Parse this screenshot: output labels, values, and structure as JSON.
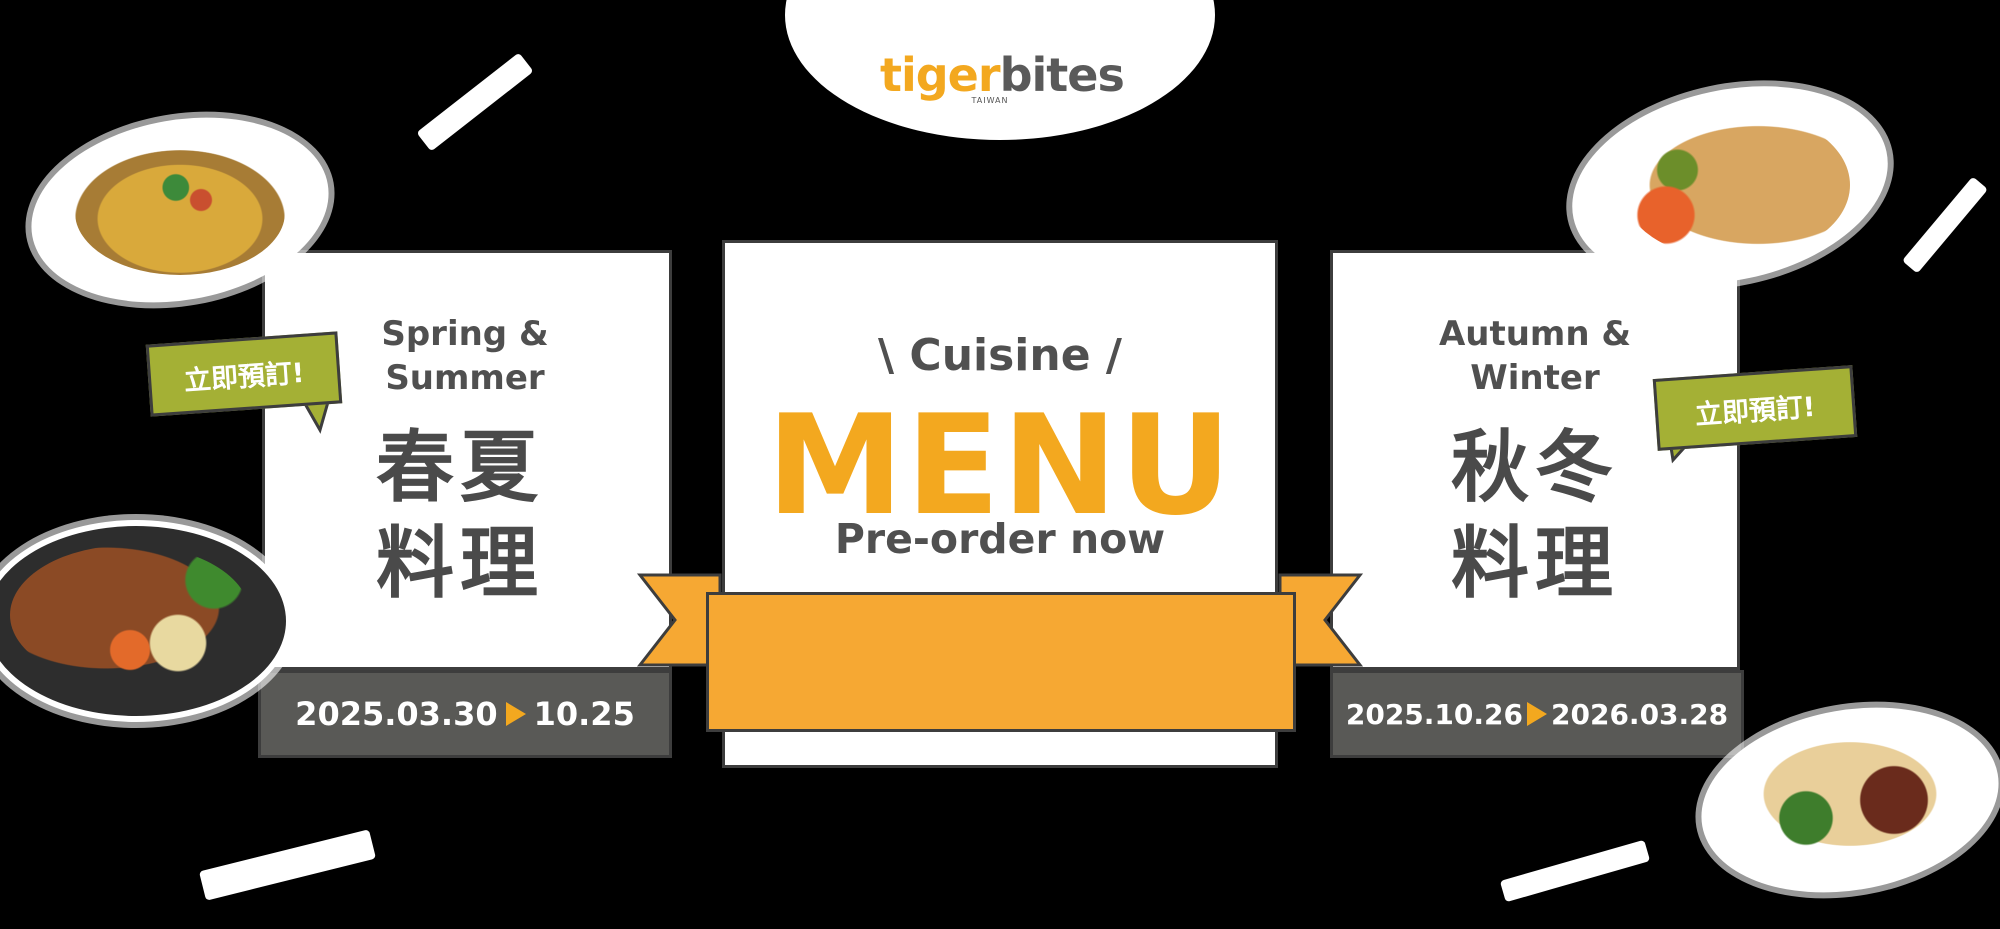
{
  "logo": {
    "brand_part1": "tiger",
    "brand_part2": "bites",
    "sub": "TAIWAN"
  },
  "center": {
    "cuisine": "\\ Cuisine /",
    "menu": "MENU",
    "preorder": "Pre-order now"
  },
  "left_card": {
    "title_line1": "Spring &",
    "title_line2": "Summer",
    "cjk_line1": "春夏",
    "cjk_line2": "料理",
    "date_start": "2025.03.30",
    "date_end": "10.25"
  },
  "right_card": {
    "title_line1": "Autumn &",
    "title_line2": "Winter",
    "cjk_line1": "秋冬",
    "cjk_line2": "料理",
    "date_start": "2025.10.26",
    "date_end": "2026.03.28"
  },
  "tags": {
    "left": "立即預訂!",
    "right": "立即預訂!"
  },
  "colors": {
    "accent": "#f3a81f",
    "tag_green": "#a4b035",
    "dark_gray": "#595956",
    "text_gray": "#505050",
    "background": "#000000"
  },
  "icons": [
    "food-plate-icon"
  ]
}
